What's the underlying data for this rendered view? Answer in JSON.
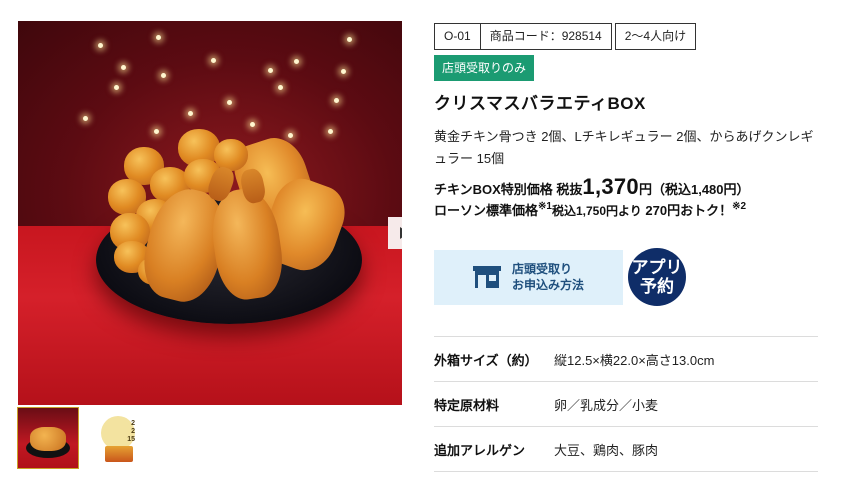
{
  "gallery": {
    "main_image_alt": "クリスマスバラエティBOX",
    "next_arrow_icon": "chevron-right-icon",
    "thumbnails": [
      {
        "name": "thumbnail-chicken-box",
        "active": true
      },
      {
        "name": "thumbnail-box-package",
        "active": false,
        "badge_text": "2\n2\n15"
      }
    ]
  },
  "product": {
    "tags": {
      "code_prefix": "O-01",
      "code": "商品コード：928514",
      "serving": "2〜4人向け"
    },
    "pickup_badge": "店頭受取りのみ",
    "name": "クリスマスバラエティBOX",
    "description": "黄金チキン骨つき 2個、Lチキレギュラー 2個、からあげクンレギュラー 15個",
    "price": {
      "label": "チキンBOX特別価格 税抜",
      "amount": "1,370",
      "unit": "円",
      "tax_included": "（税込1,480円）"
    },
    "standard": {
      "label": "ローソン標準価格",
      "note_mark_1": "※1",
      "tax_included_text": "税込1,750円より",
      "saving": "270円おトク！",
      "note_mark_2": "※2"
    }
  },
  "order": {
    "button_line1": "店頭受取り",
    "button_line2": "お申込み方法",
    "app_line1": "アプリ",
    "app_line2": "予約",
    "store_icon": "store-icon",
    "accent_color": "#1f4f7d"
  },
  "specs": [
    {
      "label": "外箱サイズ（約）",
      "value": "縦12.5×横22.0×高さ13.0cm"
    },
    {
      "label": "特定原材料",
      "value": "卵／乳成分／小麦"
    },
    {
      "label": "追加アレルゲン",
      "value": "大豆、鶏肉、豚肉"
    }
  ],
  "colors": {
    "badge_green": "#1b9b72",
    "app_badge_navy": "#0f2d68",
    "order_button_bg": "#dff0fa"
  }
}
